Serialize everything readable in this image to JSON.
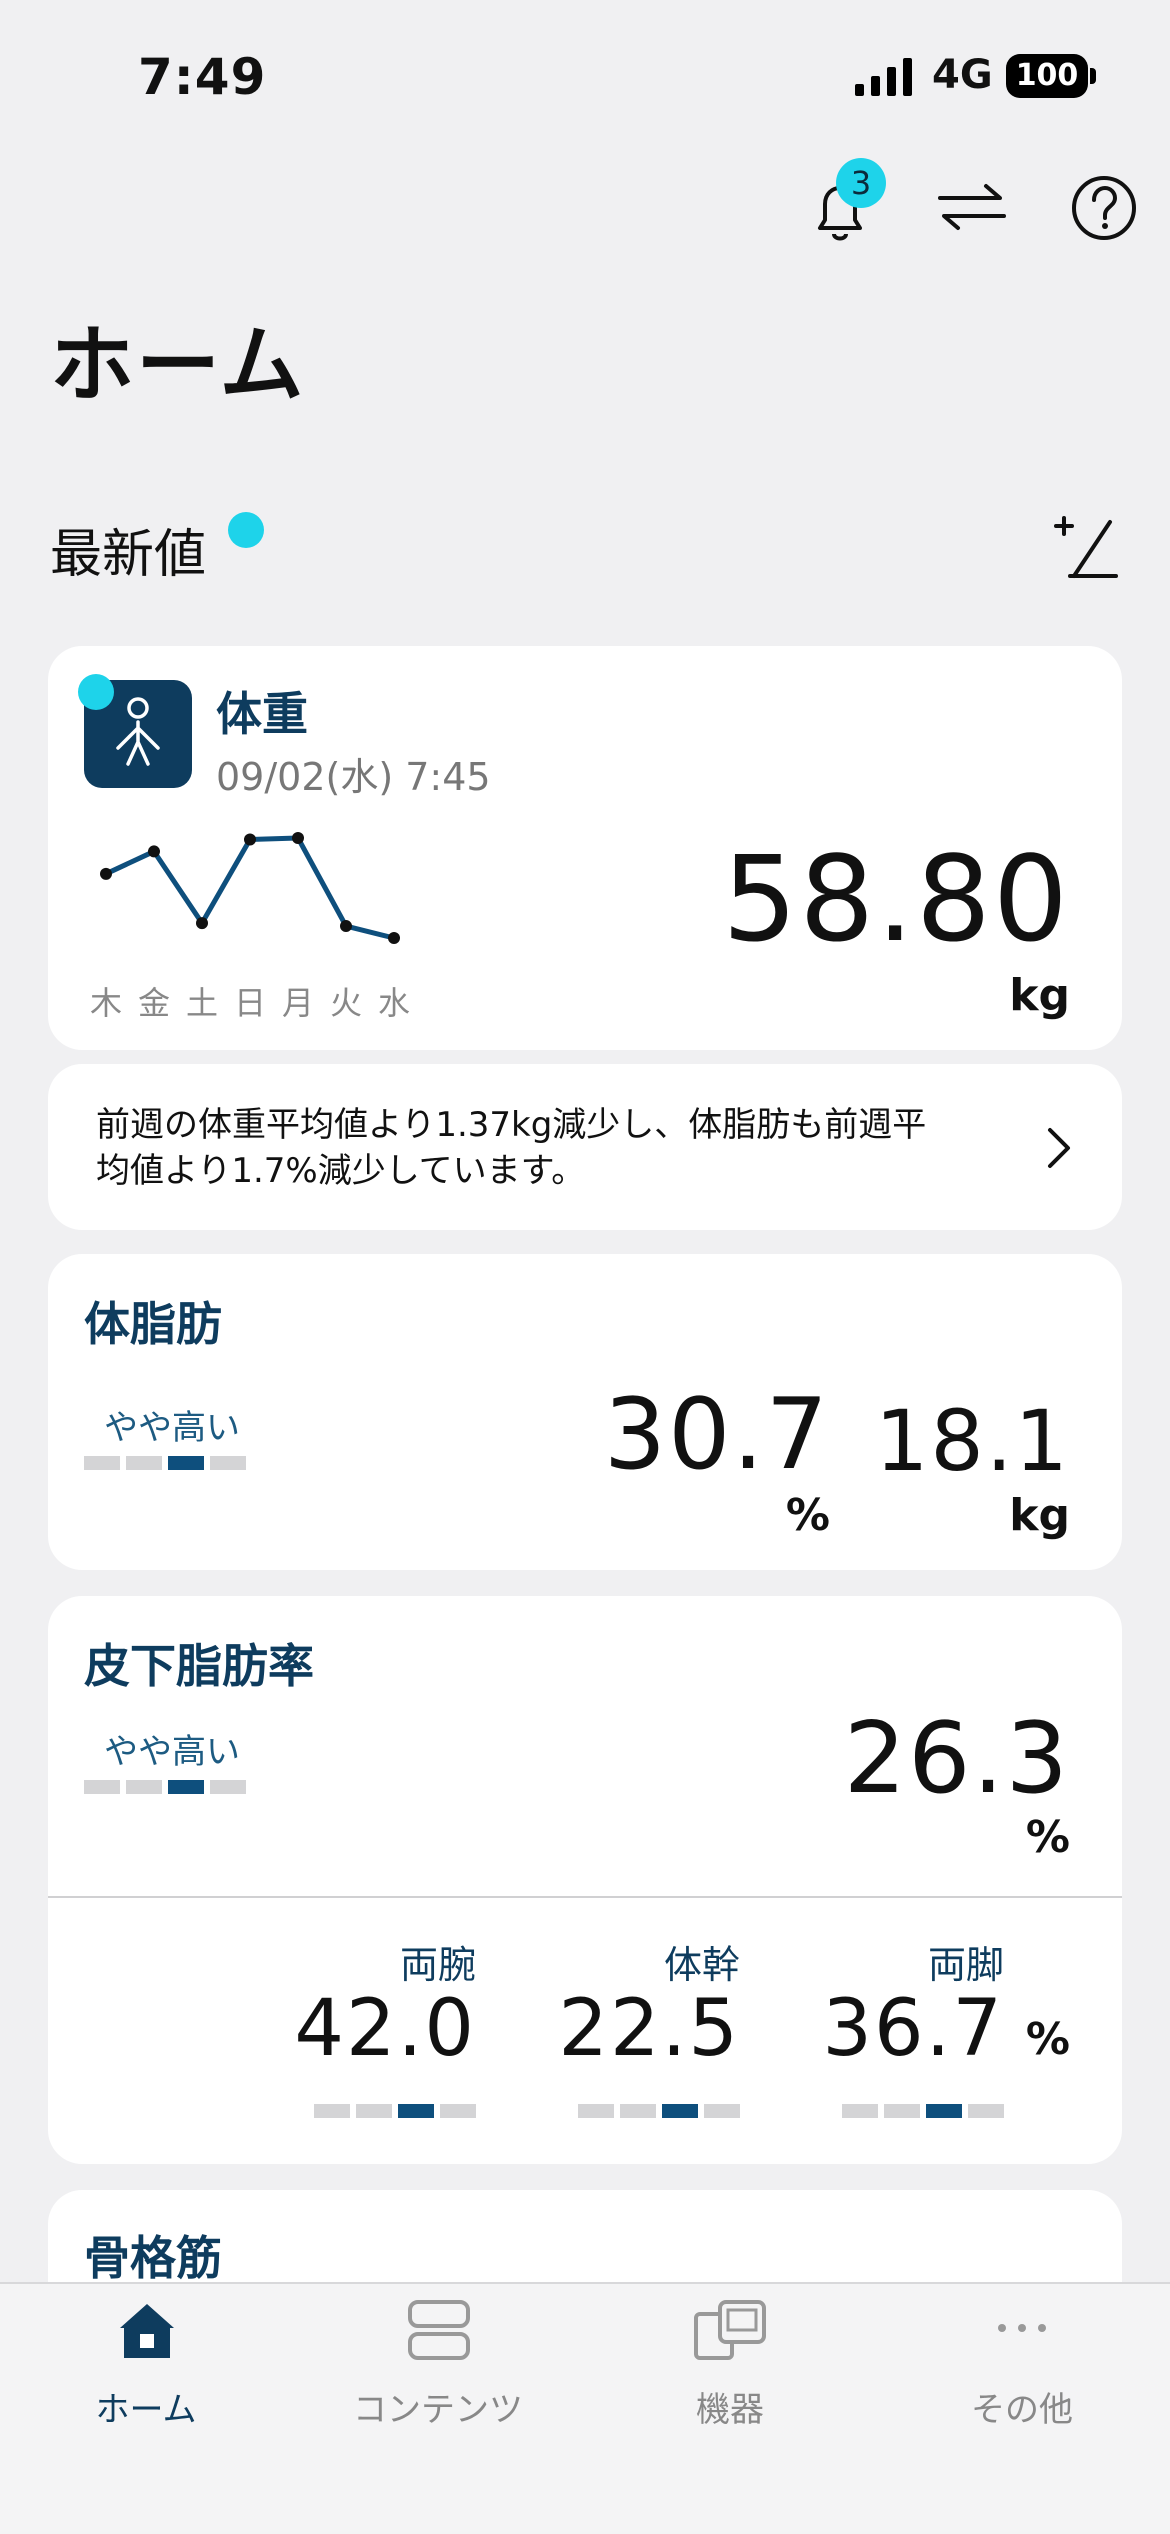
{
  "status_bar": {
    "time": "7:49",
    "network": "4G",
    "battery": "100"
  },
  "header": {
    "notification_count": "3"
  },
  "page": {
    "title": "ホーム",
    "section_title": "最新値"
  },
  "weight_card": {
    "title": "体重",
    "datetime": "09/02(水) 7:45",
    "value": "58.80",
    "unit": "kg",
    "chart_data": {
      "type": "line",
      "categories": [
        "木",
        "金",
        "土",
        "日",
        "月",
        "火",
        "水"
      ],
      "values": [
        58.95,
        59.1,
        58.62,
        59.18,
        59.19,
        58.6,
        58.52
      ]
    }
  },
  "insight": {
    "line1": "前週の体重平均値より1.37kg減少し、体脂肪も前週平",
    "line2": "均値より1.7%減少しています。"
  },
  "body_fat_card": {
    "title": "体脂肪",
    "level": "やや高い",
    "level_index": 3,
    "percent_value": "30.7",
    "percent_unit": "%",
    "mass_value": "18.1",
    "mass_unit": "kg"
  },
  "subcutaneous_card": {
    "title": "皮下脂肪率",
    "level": "やや高い",
    "level_index": 3,
    "value": "26.3",
    "unit": "%",
    "parts": [
      {
        "label": "両腕",
        "value": "42.0",
        "level_index": 3
      },
      {
        "label": "体幹",
        "value": "22.5",
        "level_index": 3
      },
      {
        "label": "両脚",
        "value": "36.7",
        "level_index": 3
      }
    ],
    "parts_unit": "%"
  },
  "muscle_card": {
    "title": "骨格筋"
  },
  "tabbar": {
    "home": "ホーム",
    "contents": "コンテンツ",
    "devices": "機器",
    "other": "その他"
  },
  "colors": {
    "accent": "#0e3c5e",
    "cyan": "#1ed3ea",
    "level_on": "#0e4f7d",
    "level_off": "#d4d4d6"
  }
}
